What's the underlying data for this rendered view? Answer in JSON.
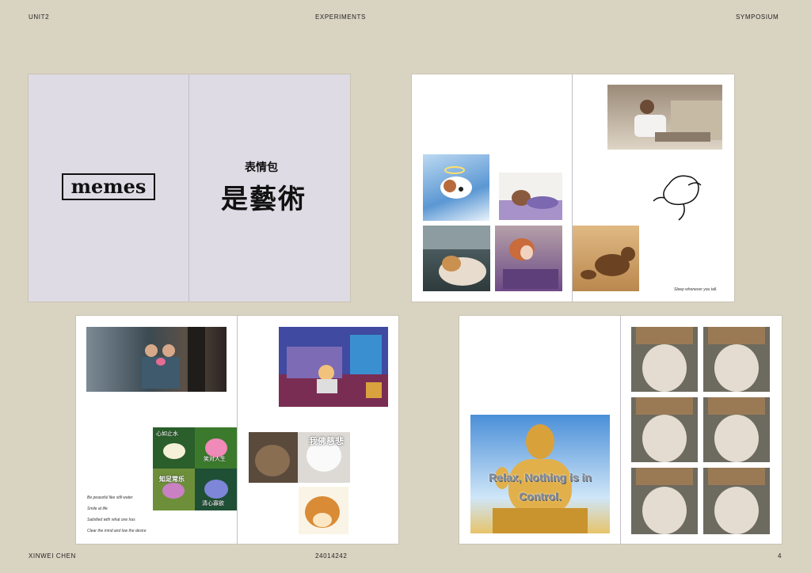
{
  "header": {
    "left": "UNIT2",
    "center": "EXPERIMENTS",
    "right": "SYMPOSIUM"
  },
  "footer": {
    "left": "XINWEI CHEN",
    "center": "24014242",
    "right": "4"
  },
  "spread1": {
    "title_en": "memes",
    "title_cn_small": "表情包",
    "title_cn_big": "是藝術"
  },
  "spread2": {
    "caption": "Sleep whenever you tall."
  },
  "spread3": {
    "lotus_labels": [
      "心如止水",
      "笑对人生",
      "知足常乐",
      "清心寡欲"
    ],
    "dog_text": "我佛慈悲",
    "captions": [
      "Be peaceful like still water",
      "Smile at life",
      "Satisfied with what one has",
      "Clear the mind and low the desire"
    ]
  },
  "spread4": {
    "meme_text": "Relax, Nothing is in Control."
  }
}
